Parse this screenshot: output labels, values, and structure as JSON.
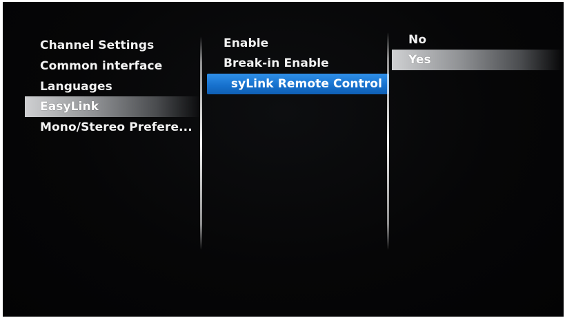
{
  "menu": {
    "column1": {
      "items": [
        {
          "label": "Channel Settings"
        },
        {
          "label": "Common interface"
        },
        {
          "label": "Languages"
        },
        {
          "label": "EasyLink"
        },
        {
          "label": "Mono/Stereo Prefere..."
        }
      ],
      "highlighted": "EasyLink"
    },
    "column2": {
      "items": [
        {
          "label": "Enable"
        },
        {
          "label": "Break-in Enable"
        },
        {
          "label": "syLink Remote Control"
        }
      ],
      "focused": "syLink Remote Control"
    },
    "column3": {
      "items": [
        {
          "label": "No"
        },
        {
          "label": "Yes"
        }
      ],
      "highlighted": "Yes"
    }
  },
  "colors": {
    "background": "#060607",
    "focus_blue": "#1670cc",
    "highlight_grey": "#8f9194",
    "text": "#f2f2f2"
  }
}
